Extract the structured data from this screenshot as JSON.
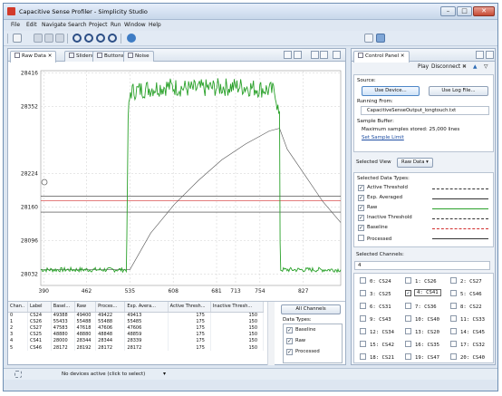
{
  "window": {
    "title": "Capacitive Sense Profiler - Simplicity Studio",
    "min": "–",
    "max": "□",
    "close": "✕"
  },
  "menu": [
    "File",
    "Edit",
    "Navigate",
    "Search",
    "Project",
    "Run",
    "Window",
    "Help"
  ],
  "tabs": [
    {
      "label": "Raw Data",
      "close": "✕"
    },
    {
      "label": "Sliders"
    },
    {
      "label": "Buttons"
    },
    {
      "label": "Noise"
    }
  ],
  "chart_data": {
    "type": "line",
    "yticks": [
      28032,
      28096,
      28160,
      28224,
      28352,
      28416
    ],
    "xticks": [
      390,
      462,
      535,
      608,
      681,
      713,
      754,
      827
    ],
    "xrange": [
      385,
      890
    ],
    "yrange": [
      28010,
      28420
    ],
    "series": [
      {
        "color": "#2aa12a",
        "points": [
          [
            385,
            28040
          ],
          [
            529,
            28040
          ],
          [
            530,
            28100
          ],
          [
            532,
            28330
          ],
          [
            536,
            28380
          ],
          [
            560,
            28385
          ],
          [
            600,
            28390
          ],
          [
            640,
            28385
          ],
          [
            680,
            28388
          ],
          [
            720,
            28390
          ],
          [
            760,
            28385
          ],
          [
            780,
            28380
          ],
          [
            787,
            28325
          ],
          [
            788,
            28095
          ],
          [
            789,
            28040
          ],
          [
            890,
            28040
          ]
        ],
        "noise": 16
      },
      {
        "color": "#555555",
        "points": [
          [
            385,
            28040
          ],
          [
            535,
            28040
          ],
          [
            570,
            28110
          ],
          [
            610,
            28165
          ],
          [
            650,
            28210
          ],
          [
            690,
            28250
          ],
          [
            730,
            28280
          ],
          [
            770,
            28305
          ],
          [
            787,
            28310
          ],
          [
            800,
            28270
          ],
          [
            830,
            28220
          ],
          [
            860,
            28170
          ],
          [
            890,
            28130
          ]
        ]
      },
      {
        "color": "#333333",
        "points": [
          [
            385,
            28180
          ],
          [
            890,
            28180
          ]
        ]
      },
      {
        "color": "#d33030",
        "points": [
          [
            385,
            28172
          ],
          [
            890,
            28172
          ]
        ]
      },
      {
        "color": "#333333",
        "points": [
          [
            385,
            28150
          ],
          [
            890,
            28150
          ]
        ]
      }
    ]
  },
  "table": {
    "headers": [
      "Chan..",
      "Label",
      "Basel...",
      "Raw",
      "Proces...",
      "Exp. Avera...",
      "Active Thresh...",
      "Inactive Thresh..."
    ],
    "rows": [
      [
        "0",
        "CS24",
        "49388",
        "49400",
        "49422",
        "49413",
        "175",
        "150"
      ],
      [
        "1",
        "CS26",
        "55433",
        "55488",
        "55488",
        "55485",
        "175",
        "150"
      ],
      [
        "2",
        "CS27",
        "47583",
        "47618",
        "47606",
        "47606",
        "175",
        "150"
      ],
      [
        "3",
        "CS25",
        "48880",
        "48880",
        "48848",
        "48859",
        "175",
        "150"
      ],
      [
        "4",
        "CS41",
        "28000",
        "28344",
        "28344",
        "28339",
        "175",
        "150"
      ],
      [
        "5",
        "CS46",
        "28172",
        "28192",
        "28172",
        "28172",
        "175",
        "150"
      ]
    ],
    "all_channels": "All Channels",
    "data_types_label": "Data Types:",
    "data_types": [
      {
        "label": "Baseline",
        "checked": true
      },
      {
        "label": "Raw",
        "checked": true
      },
      {
        "label": "Processed",
        "checked": true
      }
    ]
  },
  "status": {
    "text": "No devices active (click to select)"
  },
  "control": {
    "tab": "Control Panel",
    "close": "✕",
    "play": "Play",
    "disconnect": "Disconnect",
    "source_label": "Source:",
    "use_device": "Use Device...",
    "use_log": "Use Log File...",
    "running_from": "Running From:",
    "output_file": "CapacitiveSenseOutput_longtouch.txt",
    "sample_buffer": "Sample Buffer:",
    "max_samples": "Maximum samples stored: 25,000 lines",
    "set_limit": "Set Sample Limit",
    "selected_view_label": "Selected View",
    "selected_view": "Raw Data",
    "data_types_label": "Selected Data Types:",
    "data_types": [
      {
        "label": "Active Threshold",
        "checked": true,
        "color": "#333333",
        "dashed": true
      },
      {
        "label": "Exp. Averaged",
        "checked": true,
        "color": "#333333",
        "dashed": false
      },
      {
        "label": "Raw",
        "checked": true,
        "color": "#2aa12a",
        "dashed": false
      },
      {
        "label": "Inactive Threshold",
        "checked": true,
        "color": "#333333",
        "dashed": true
      },
      {
        "label": "Baseline",
        "checked": true,
        "color": "#d33030",
        "dashed": true
      },
      {
        "label": "Processed",
        "checked": false,
        "color": "#333333",
        "dashed": false
      }
    ],
    "channels_label": "Selected Channels:",
    "channel_search": "4",
    "channels": [
      "0: CS24",
      "1: CS26",
      "2: CS27",
      "3: CS25",
      "4: CS41",
      "5: CS46",
      "6: CS31",
      "7: CS36",
      "8: CS22",
      "9: CS43",
      "10: CS40",
      "11: CS33",
      "12: CS34",
      "13: CS20",
      "14: CS45",
      "15: CS42",
      "16: CS35",
      "17: CS32",
      "18: CS21",
      "19: CS47",
      "20: CS40"
    ],
    "selected_channel": 4
  }
}
